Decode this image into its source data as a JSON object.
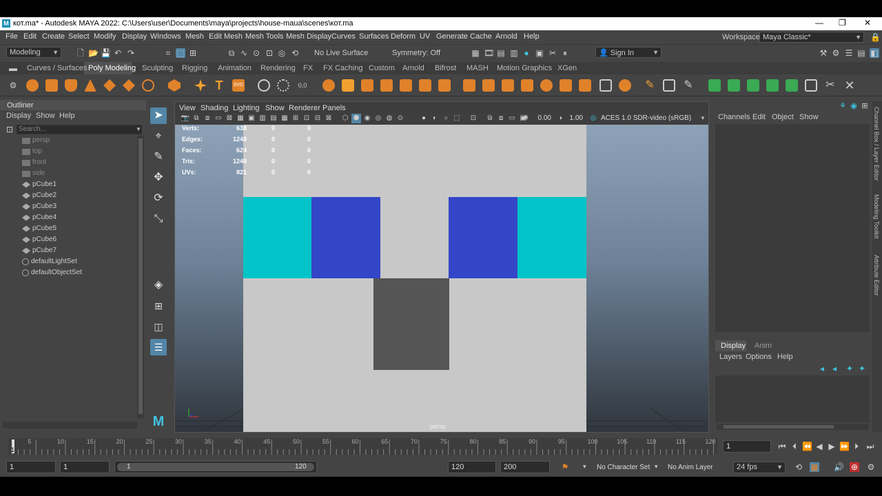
{
  "window": {
    "title": "кот.ma* - Autodesk MAYA 2022: C:\\Users\\user\\Documents\\maya\\projects\\house-maua\\scenes\\кот.ma",
    "logo": "M",
    "min": "—",
    "restore": "❐",
    "close": "✕"
  },
  "menubar": {
    "items": [
      "File",
      "Edit",
      "Create",
      "Select",
      "Modify",
      "Display",
      "Windows",
      "Mesh",
      "Edit Mesh",
      "Mesh Tools",
      "Mesh Display",
      "Curves",
      "Surfaces",
      "Deform",
      "UV",
      "Generate",
      "Cache",
      "Arnold",
      "Help"
    ],
    "workspace_label": "Workspace :",
    "workspace_value": "Maya Classic*"
  },
  "statusline": {
    "mode": "Modeling",
    "live_surface": "No Live Surface",
    "symmetry": "Symmetry: Off",
    "sign_in": "Sign In"
  },
  "shelf": {
    "tabs": [
      "Curves / Surfaces",
      "Poly Modeling",
      "Sculpting",
      "Rigging",
      "Animation",
      "Rendering",
      "FX",
      "FX Caching",
      "Custom",
      "Arnold",
      "Bifrost",
      "MASH",
      "Motion Graphics",
      "XGen"
    ],
    "active_tab": "Poly Modeling"
  },
  "outliner": {
    "title": "Outliner",
    "menu": [
      "Display",
      "Show",
      "Help"
    ],
    "search_placeholder": "Search...",
    "items": [
      {
        "label": "persp",
        "type": "camera",
        "dim": true
      },
      {
        "label": "top",
        "type": "camera",
        "dim": true
      },
      {
        "label": "front",
        "type": "camera",
        "dim": true
      },
      {
        "label": "side",
        "type": "camera",
        "dim": true
      },
      {
        "label": "pCube1",
        "type": "mesh",
        "dim": false
      },
      {
        "label": "pCube2",
        "type": "mesh",
        "dim": false
      },
      {
        "label": "pCube3",
        "type": "mesh",
        "dim": false
      },
      {
        "label": "pCube4",
        "type": "mesh",
        "dim": false
      },
      {
        "label": "pCube5",
        "type": "mesh",
        "dim": false
      },
      {
        "label": "pCube6",
        "type": "mesh",
        "dim": false
      },
      {
        "label": "pCube7",
        "type": "mesh",
        "dim": false
      },
      {
        "label": "defaultLightSet",
        "type": "set",
        "dim": false
      },
      {
        "label": "defaultObjectSet",
        "type": "set",
        "dim": false
      }
    ]
  },
  "viewport": {
    "menu": [
      "View",
      "Shading",
      "Lighting",
      "Show",
      "Renderer",
      "Panels"
    ],
    "exposure": "0.00",
    "gamma": "1.00",
    "color_space": "ACES 1.0 SDR-video (sRGB)",
    "camera_label": "persp",
    "hud": [
      {
        "label": "Verts:",
        "v1": "638",
        "v2": "0",
        "v3": "0"
      },
      {
        "label": "Edges:",
        "v1": "1248",
        "v2": "0",
        "v3": "0"
      },
      {
        "label": "Faces:",
        "v1": "624",
        "v2": "0",
        "v3": "0"
      },
      {
        "label": "Tris:",
        "v1": "1248",
        "v2": "0",
        "v3": "0"
      },
      {
        "label": "UVs:",
        "v1": "821",
        "v2": "0",
        "v3": "0"
      }
    ],
    "colors": {
      "cube_face": "#c8c8c8",
      "eye_cyan": "#00c4c8",
      "eye_blue": "#3446c8",
      "nose": "#555555"
    }
  },
  "channelbox": {
    "menu": [
      "Channels",
      "Edit",
      "Object",
      "Show"
    ],
    "layer_tabs": [
      "Display",
      "Anim"
    ],
    "layer_menu": [
      "Layers",
      "Options",
      "Help"
    ],
    "side_tabs": [
      "Channel Box / Layer Editor",
      "Modeling Toolkit",
      "Attribute Editor"
    ]
  },
  "timeline": {
    "ticks": [
      "5",
      "10",
      "15",
      "20",
      "25",
      "30",
      "35",
      "40",
      "45",
      "50",
      "55",
      "60",
      "65",
      "70",
      "75",
      "80",
      "85",
      "90",
      "95",
      "100",
      "105",
      "110",
      "115",
      "120"
    ],
    "current_frame_marker": "1",
    "current_frame": "1"
  },
  "range": {
    "start": "1",
    "playback_start": "1",
    "slider_start": "1",
    "slider_end": "120",
    "playback_end": "120",
    "end": "200",
    "character_set": "No Character Set",
    "anim_layer": "No Anim Layer",
    "fps": "24 fps"
  }
}
